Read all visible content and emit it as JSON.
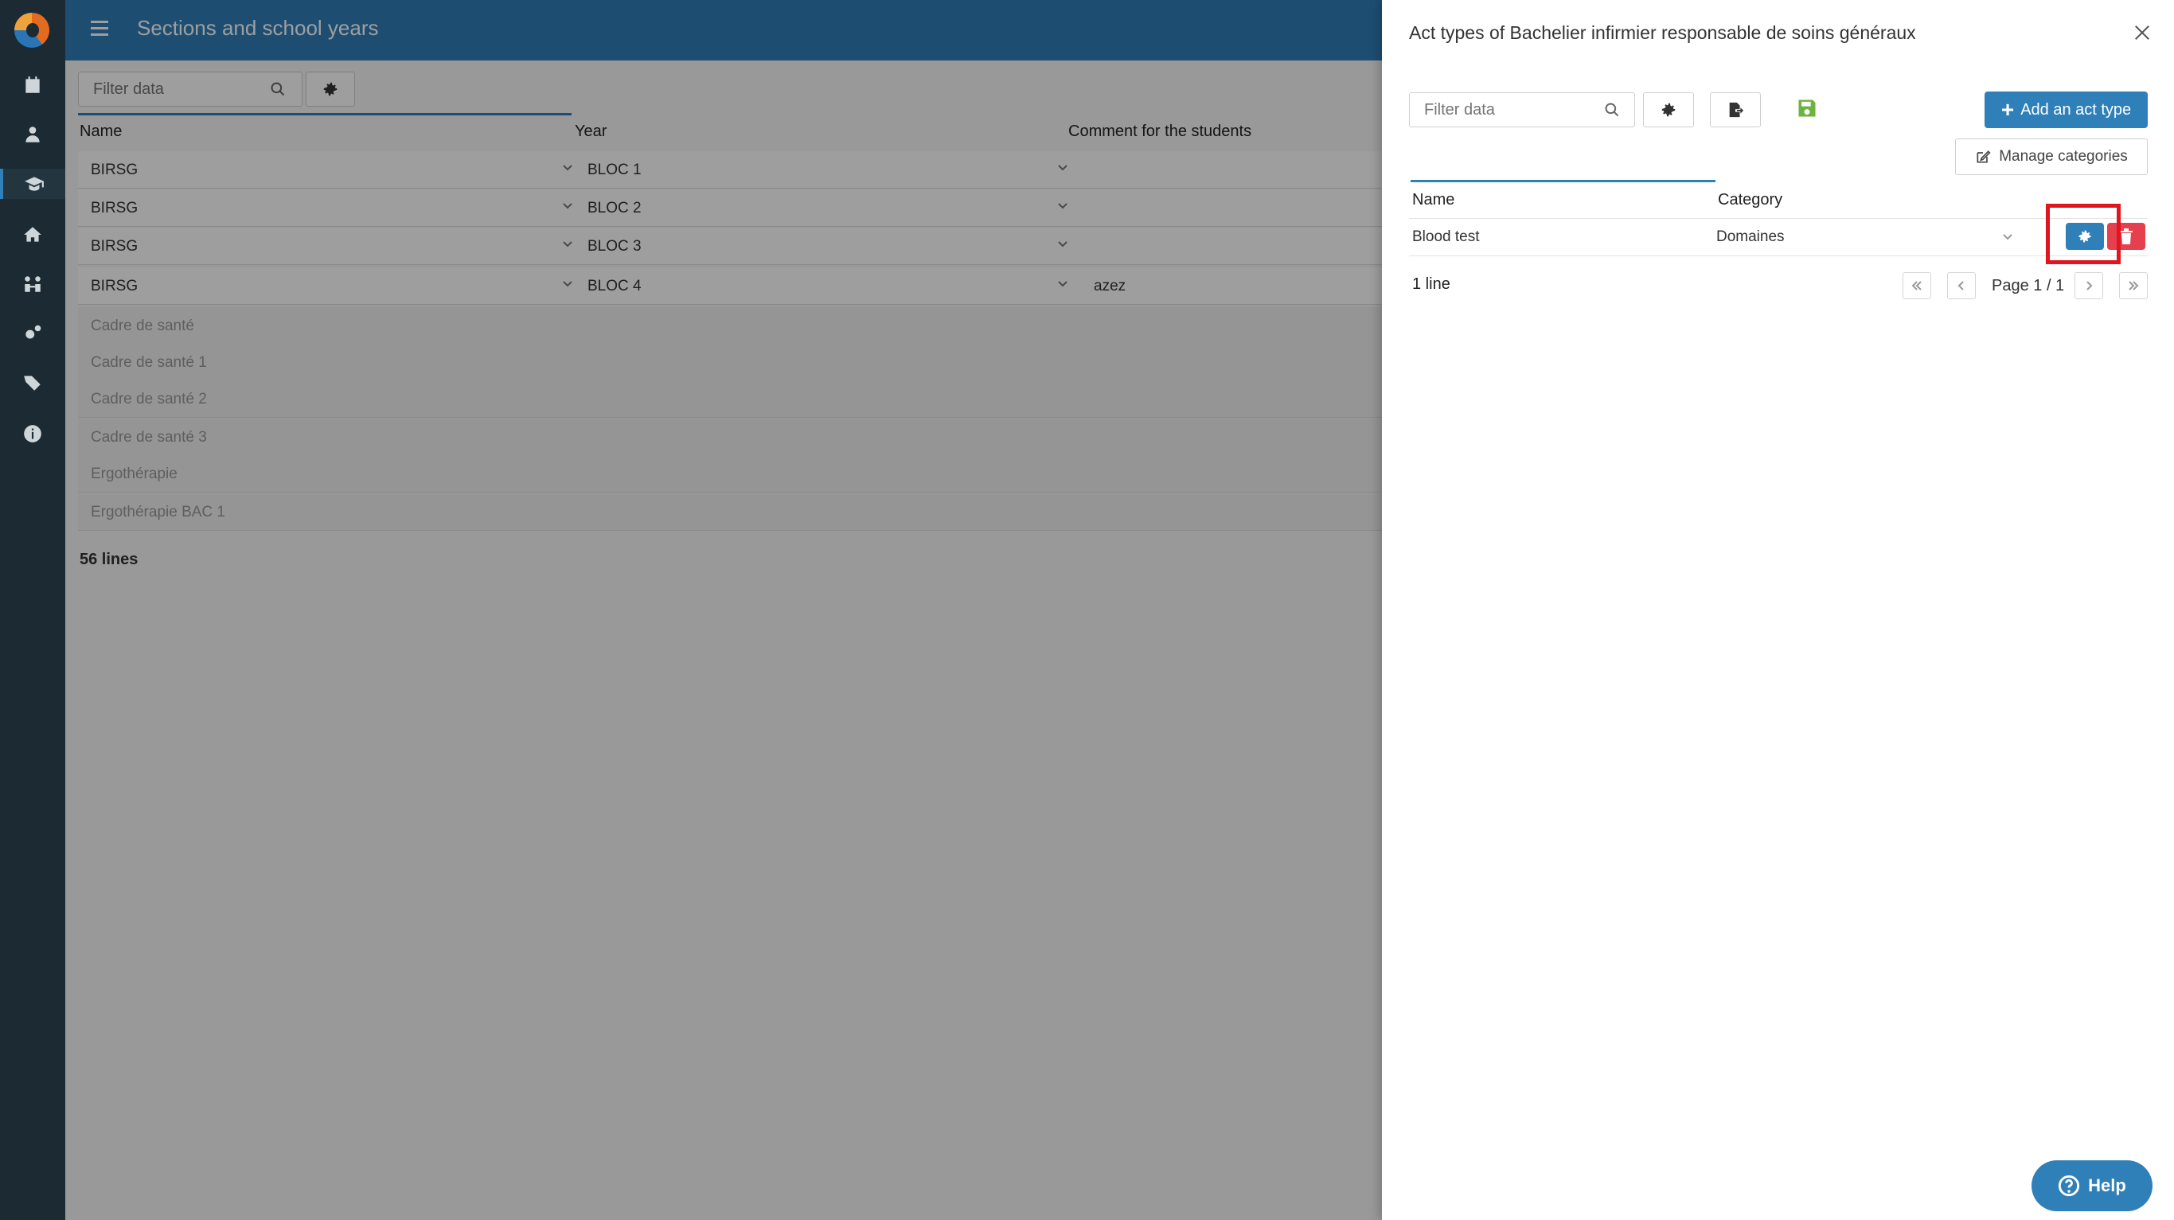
{
  "app": {
    "page_title": "Sections and school years",
    "filter_placeholder": "Filter data",
    "columns": {
      "name": "Name",
      "year": "Year",
      "comment": "Comment for the students"
    },
    "rows": [
      {
        "name": "BIRSG",
        "year": "BLOC 1",
        "comment": "",
        "active": true
      },
      {
        "name": "BIRSG",
        "year": "BLOC 2",
        "comment": "",
        "active": true
      },
      {
        "name": "BIRSG",
        "year": "BLOC 3",
        "comment": "",
        "active": true
      },
      {
        "name": "BIRSG",
        "year": "BLOC 4",
        "comment": "azez",
        "active": true
      },
      {
        "name": "Cadre de santé",
        "year": "",
        "comment": "",
        "active": false
      },
      {
        "name": "Cadre de santé 1",
        "year": "",
        "comment": "",
        "active": false
      },
      {
        "name": "Cadre de santé 2",
        "year": "",
        "comment": "",
        "active": false
      },
      {
        "name": "Cadre de santé 3",
        "year": "",
        "comment": "",
        "active": false
      },
      {
        "name": "Ergothérapie",
        "year": "",
        "comment": "",
        "active": false
      },
      {
        "name": "Ergothérapie BAC 1",
        "year": "",
        "comment": "",
        "active": false
      }
    ],
    "lines_count": "56 lines"
  },
  "sidebar": {
    "items": [
      {
        "icon": "calendar-icon"
      },
      {
        "icon": "teacher-icon"
      },
      {
        "icon": "graduation-cap-icon",
        "active": true
      },
      {
        "icon": "home-icon"
      },
      {
        "icon": "people-icon"
      },
      {
        "icon": "gears-icon"
      },
      {
        "icon": "tags-icon"
      },
      {
        "icon": "info-icon"
      }
    ]
  },
  "drawer": {
    "title": "Act types of Bachelier infirmier responsable de soins généraux",
    "filter_placeholder": "Filter data",
    "add_label": "Add an act type",
    "manage_label": "Manage categories",
    "columns": {
      "name": "Name",
      "category": "Category"
    },
    "rows": [
      {
        "name": "Blood test",
        "category": "Domaines"
      }
    ],
    "lines_count": "1 line",
    "page_label": "Page 1 / 1",
    "help_label": "Help"
  },
  "colors": {
    "primary": "#2f7fb9",
    "danger": "#e6404e",
    "highlight": "#e1151e",
    "save": "#6db33f",
    "sidebar": "#1b2a33"
  }
}
